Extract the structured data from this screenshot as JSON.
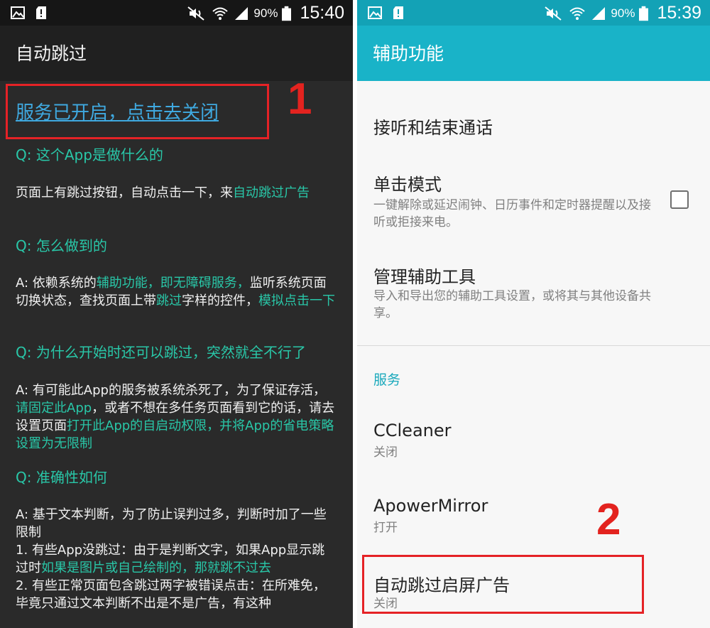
{
  "left": {
    "status": {
      "battery": "90%",
      "time": "15:40"
    },
    "title": "自动跳过",
    "service_link": "服务已开启，点击去关闭",
    "annotation": "1",
    "faq": {
      "q1": "Q: 这个App是做什么的",
      "a1_part1": "页面上有跳过按钮，自动点击一下，来",
      "a1_hl1": "自动跳过广告",
      "q2": "Q: 怎么做到的",
      "a2_part1": "A: 依赖系统的",
      "a2_hl1": "辅助功能，即无障碍服务，",
      "a2_part2": "监听系统页面切换状态，查找页面上带",
      "a2_hl2": "跳过",
      "a2_part3": "字样的控件，",
      "a2_hl3": "模拟点击一下",
      "q3": "Q: 为什么开始时还可以跳过，突然就全不行了",
      "a3_part1": "A: 有可能此App的服务被系统杀死了，为了保证存活，",
      "a3_hl1": "请固定此App",
      "a3_part2": "，或者不想在多任务页面看到它的话，请去设置页面",
      "a3_hl2": "打开此App的自启动权限，并将App的省电策略设置为无限制",
      "q4": "Q: 准确性如何",
      "a4_part1": "A: 基于文本判断，为了防止误判过多，判断时加了一些限制",
      "a4_line2": " 1. 有些App没跳过：由于是判断文字，如果App显示跳过时",
      "a4_hl1": "如果是图片或自己绘制的，那就跳不过去",
      "a4_line3": " 2. 有些正常页面包含跳过两字被错误点击：在所难免，毕竟只通过文本判断不出是不是广告，有这种"
    }
  },
  "right": {
    "status": {
      "battery": "90%",
      "time": "15:39"
    },
    "title": "辅助功能",
    "items": [
      {
        "title": "接听和结束通话"
      },
      {
        "title": "单击模式",
        "sub": "一键解除或延迟闹钟、日历事件和定时器提醒以及接听或拒接来电。"
      },
      {
        "title": "管理辅助工具",
        "sub": "导入和导出您的辅助工具设置，或将其与其他设备共享。"
      }
    ],
    "section": "服务",
    "services": [
      {
        "title": "CCleaner",
        "status": "关闭"
      },
      {
        "title": "ApowerMirror",
        "status": "打开"
      },
      {
        "title": "自动跳过启屏广告",
        "status": "关闭"
      }
    ],
    "annotation": "2"
  },
  "colors": {
    "accent_teal": "#19b3c8",
    "faq_green": "#29c7a8",
    "link_blue": "#3fa9e0",
    "annotation_red": "#e52226"
  }
}
